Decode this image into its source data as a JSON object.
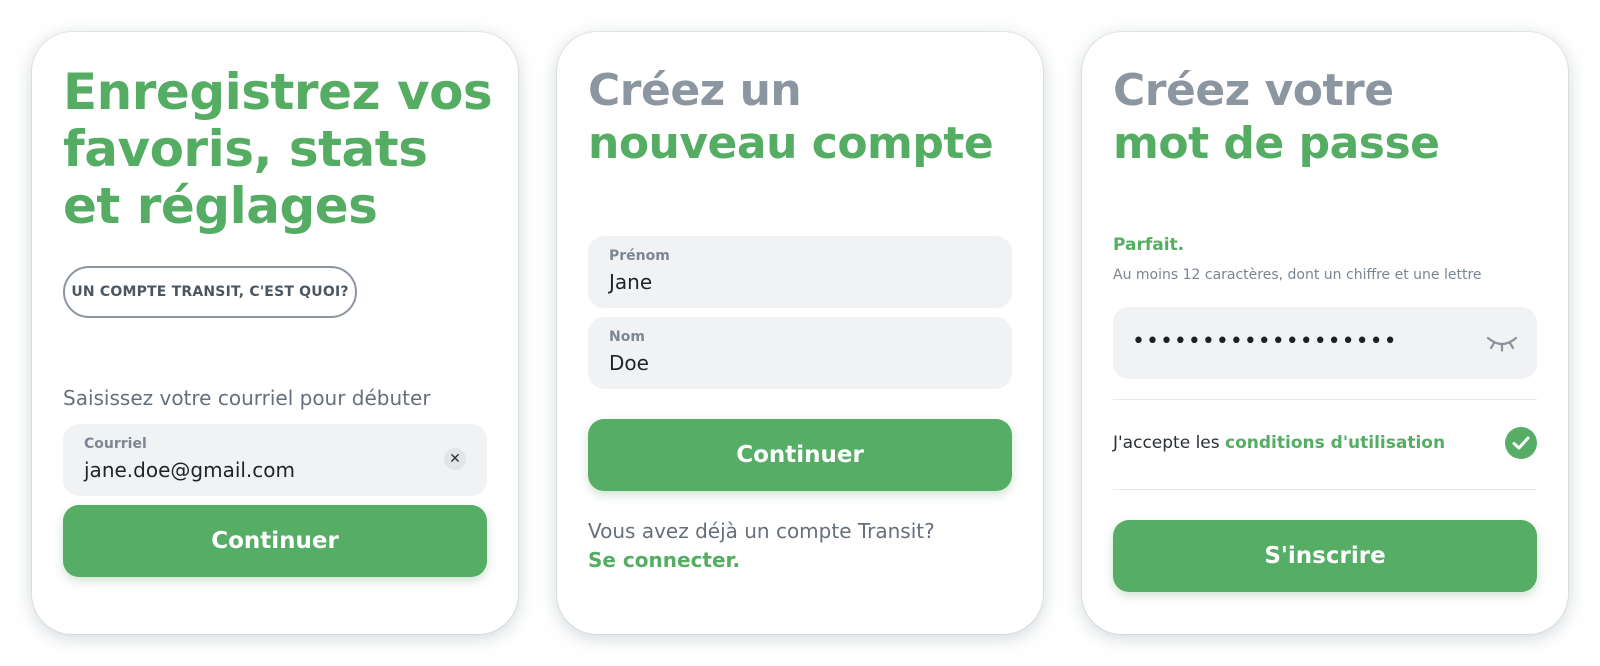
{
  "colors": {
    "accent": "#56ae66",
    "muted_heading": "#8c96a1",
    "field_bg": "#f1f2f4"
  },
  "email_card": {
    "title": "Enregistrez vos favoris, stats et réglages",
    "what_is_button": "UN COMPTE TRANSIT, C'EST QUOI?",
    "prompt": "Saisissez votre courriel pour débuter",
    "email": {
      "label": "Courriel",
      "value": "jane.doe@gmail.com",
      "clear_icon": "close-icon"
    },
    "continue_label": "Continuer"
  },
  "name_card": {
    "title_line1": "Créez un",
    "title_line2": "nouveau compte",
    "first_name": {
      "label": "Prénom",
      "value": "Jane"
    },
    "last_name": {
      "label": "Nom",
      "value": "Doe"
    },
    "continue_label": "Continuer",
    "existing_account_text": "Vous avez déjà un compte Transit?",
    "login_link": "Se connecter."
  },
  "password_card": {
    "title_line1": "Créez votre",
    "title_line2": "mot de passe",
    "strength_status": "Parfait.",
    "hint": "Au moins 12 caractères, dont un chiffre et une lettre",
    "password_mask": "•••••••••••••••••••",
    "reveal_icon": "eye-closed-icon",
    "terms_prefix": "J'accepte les ",
    "terms_link": "conditions d'utilisation",
    "terms_checked_icon": "checkmark-icon",
    "signup_label": "S'inscrire"
  }
}
